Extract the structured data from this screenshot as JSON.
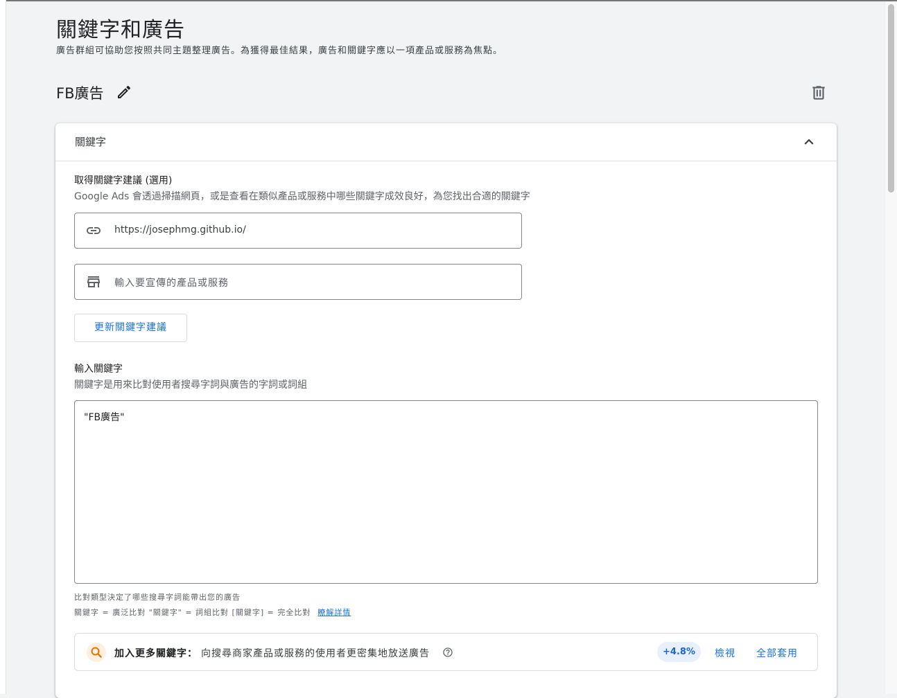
{
  "header": {
    "title": "關鍵字和廣告",
    "subtitle": "廣告群組可協助您按照共同主題整理廣告。為獲得最佳結果，廣告和關鍵字應以一項產品或服務為焦點。"
  },
  "ad_group": {
    "name": "FB廣告",
    "edit_icon": "pencil-icon",
    "delete_icon": "trash-icon"
  },
  "keywords_card": {
    "header_title": "關鍵字",
    "collapse_icon": "chevron-up-icon",
    "suggestions": {
      "title": "取得關鍵字建議 (選用)",
      "description": "Google Ads 會透過掃描網頁，或是查看在類似產品或服務中哪些關鍵字成效良好，為您找出合適的關鍵字",
      "url_field": {
        "icon": "link-icon",
        "value": "https://josephmg.github.io/"
      },
      "product_field": {
        "icon": "storefront-icon",
        "placeholder": "輸入要宣傳的產品或服務"
      },
      "update_button_label": "更新關鍵字建議"
    },
    "enter_keywords": {
      "title": "輸入關鍵字",
      "description": "關鍵字是用來比對使用者搜尋字詞與廣告的字詞或詞組",
      "textarea_value": "\"FB廣告\""
    },
    "match_hint": {
      "line1": "比對類型決定了哪些搜尋字詞能帶出您的廣告",
      "line2": "關鍵字 = 廣泛比對  \"關鍵字\" = 詞組比對  [關鍵字] = 完全比對",
      "learn_more": "瞭解詳情"
    },
    "recommendation": {
      "icon": "search-icon",
      "title": "加入更多關鍵字：",
      "text": "向搜尋商家產品或服務的使用者更密集地放送廣告",
      "help_icon": "help-icon",
      "uplift": "+4.8%",
      "view_label": "檢視",
      "apply_all_label": "全部套用"
    }
  }
}
